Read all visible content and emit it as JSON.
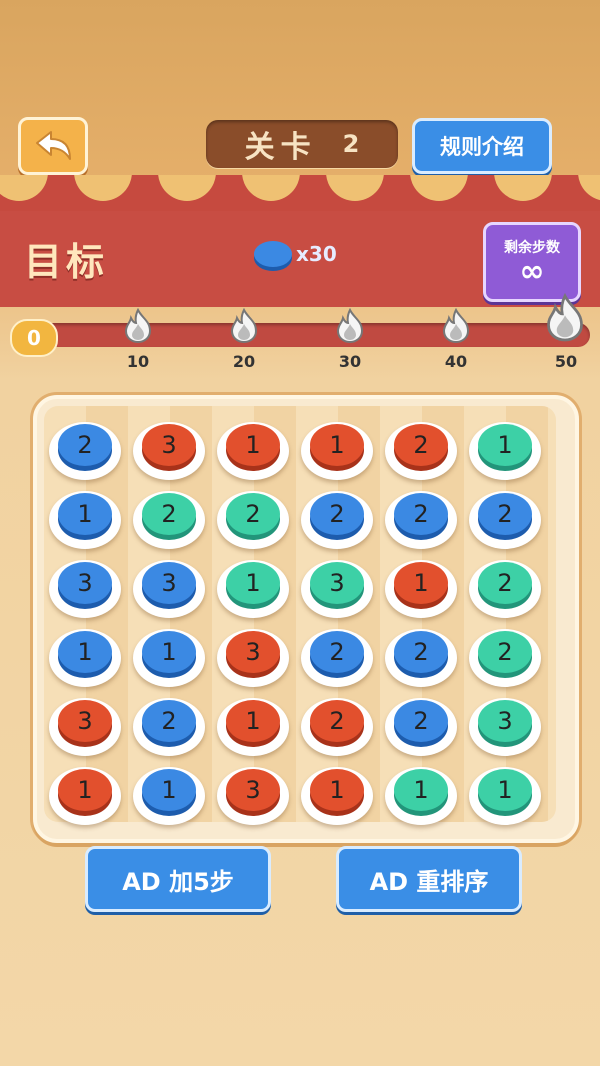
{
  "header": {
    "level_label": "关卡",
    "level_number": "2",
    "rules_label": "规则介绍",
    "back_icon": "back-arrow-icon"
  },
  "goal": {
    "title": "目标",
    "target_color": "#3b89e3",
    "target_count": "x30"
  },
  "steps": {
    "label": "剩余步数",
    "value": "∞"
  },
  "progress": {
    "current": "0",
    "milestones": [
      "10",
      "20",
      "30",
      "40",
      "50"
    ]
  },
  "board": {
    "columns": 6,
    "rows": [
      [
        {
          "c": "blue",
          "n": "2"
        },
        {
          "c": "red",
          "n": "3"
        },
        {
          "c": "red",
          "n": "1"
        },
        {
          "c": "red",
          "n": "1"
        },
        {
          "c": "red",
          "n": "2"
        },
        {
          "c": "green",
          "n": "1"
        }
      ],
      [
        {
          "c": "blue",
          "n": "1"
        },
        {
          "c": "green",
          "n": "2"
        },
        {
          "c": "green",
          "n": "2"
        },
        {
          "c": "blue",
          "n": "2"
        },
        {
          "c": "blue",
          "n": "2"
        },
        {
          "c": "blue",
          "n": "2"
        }
      ],
      [
        {
          "c": "blue",
          "n": "3"
        },
        {
          "c": "blue",
          "n": "3"
        },
        {
          "c": "green",
          "n": "1"
        },
        {
          "c": "green",
          "n": "3"
        },
        {
          "c": "red",
          "n": "1"
        },
        {
          "c": "green",
          "n": "2"
        }
      ],
      [
        {
          "c": "blue",
          "n": "1"
        },
        {
          "c": "blue",
          "n": "1"
        },
        {
          "c": "red",
          "n": "3"
        },
        {
          "c": "blue",
          "n": "2"
        },
        {
          "c": "blue",
          "n": "2"
        },
        {
          "c": "green",
          "n": "2"
        }
      ],
      [
        {
          "c": "red",
          "n": "3"
        },
        {
          "c": "blue",
          "n": "2"
        },
        {
          "c": "red",
          "n": "1"
        },
        {
          "c": "red",
          "n": "2"
        },
        {
          "c": "blue",
          "n": "2"
        },
        {
          "c": "green",
          "n": "3"
        }
      ],
      [
        {
          "c": "red",
          "n": "1"
        },
        {
          "c": "blue",
          "n": "1"
        },
        {
          "c": "red",
          "n": "3"
        },
        {
          "c": "red",
          "n": "1"
        },
        {
          "c": "green",
          "n": "1"
        },
        {
          "c": "green",
          "n": "1"
        }
      ]
    ],
    "colors": {
      "blue": "#3b89e3",
      "red": "#e2502d",
      "green": "#3dd0a6"
    }
  },
  "buttons": {
    "add_steps": "AD 加5步",
    "reshuffle": "AD 重排序"
  }
}
